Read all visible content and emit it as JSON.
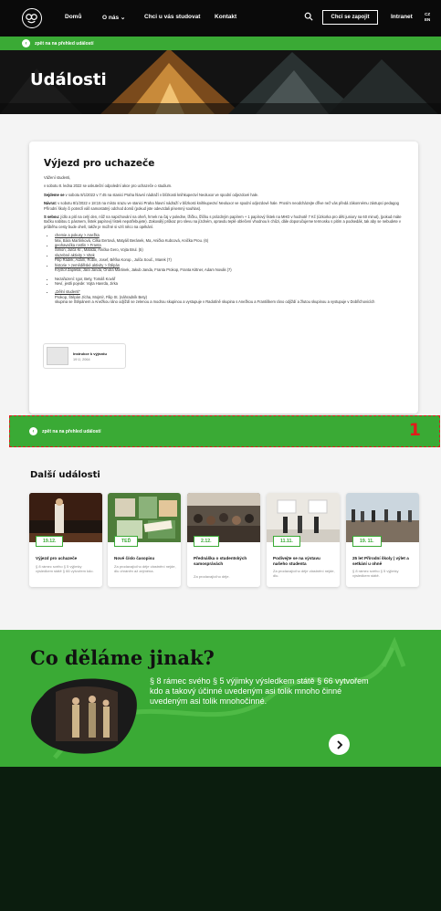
{
  "header": {
    "nav": [
      "Domů",
      "O nás ⌄",
      "Chci u vás studovat",
      "Kontakt"
    ],
    "join_button": "Chci se zapojit",
    "intranet": "Intranet",
    "lang_top": "CZ",
    "lang_bottom": "EN"
  },
  "back_bar": {
    "label": "zpět na na přehled událostí"
  },
  "hero": {
    "title": "Události"
  },
  "article": {
    "title": "Výjezd pro uchazeče",
    "greeting": "Vážení studenti,",
    "p1": "v sobotu 8. ledna 2022 se uskuteční odpolední akce pro uchazeče o studium.",
    "p2_label": "Sejdeme se",
    "p2": " v sobotu 8/1/2022 v 7:45 na stanici Praha hlavní nádraží v blízkosti knihkupectví Neoluxor ve spodní odjezdové hale.",
    "p3_label": "Návrat:",
    "p3": " v sobotu 8/1/2022 v 18:15 na místo srazu ve stanici Praha hlavní nádraží v blízkosti knihkupectví Neoluxor ve spodní odjezdové hale. Prosím neodcházejte dříve než vás předá zákonnému zástupci pedagog Přírodní školy či potvrdí váš samostatný odchod domů (pokud jste odevzdali písemný souhlas).",
    "p4_label": "S sebou:",
    "p4": " jídlo a pití na celý den, nůž na napichování na oheň, hrnek na čaj v poledne, lžičku, lžičku s prázdným papírem + 1 papírový lístek na MHD v hodnotě 7 Kč (úzkorka pro děti juniory na 60 minut), (pokud máte Itačku nabitou 1 pásmem, lístek papírový lístek nepotřebujete). Zakoválý průkaz pro slevu na jízdném, opravdu teplé oblečení vhodnou k chůzi, dále doporučujeme termosku s pitím a podsedák, tak aby se nebudete v průběhu cesty bude oheň, takže je možné si vzít něco na opékání.",
    "groups": [
      {
        "link": "chemie a pokusy > Anežka",
        "members": "Mai, Bára Martínková, Cilka Eertová, Matyáš Beránek, Ma, Anička Kubcová, Anička Prou. (6)"
      },
      {
        "link": "geohavačka rostlin > Franta",
        "members": "Šimon, Julča Kr., Matilda, Anička Gero, Vojta Brul. (5)"
      },
      {
        "link": "sluzebné aktivity > Vitek",
        "members": "Filip Rádek, Adam, Robin, Josef, Běťka Korop., Julča Souč., Marek (7)"
      },
      {
        "link": "historie > zemědělské aktivity > Štěpán",
        "members": "Kryštof Zapletal, Jára Janda, Ondra Martinek, Jakub Janda, Franta Prokop, Franta Kittner, Adam Novák (7)"
      }
    ],
    "extra": [
      "Nezařazení: Igor, Bety, Tomáš Kovář",
      "Neví, jestli pojede: Vojta Havrda, Jirka"
    ],
    "group5_link": "„Dělní studenti\"",
    "group5_members": "Prokop, Štěpán Jícha, Mojmír, Filip St. (náhradník Bety)",
    "group5_note": "skupina se Štěpánem a Anežkou ráno odjíždí se zelenou a modrou skupinou a vystupuje v Radotíně skupina s Anežkou a Františkem ráno odjíždí a žlutou skupinou a vystupuje v Dobřichovicích",
    "attachment": {
      "name": "Instrukce k výjezdu",
      "meta": "19 Ü, 2064"
    }
  },
  "more_events": {
    "title": "Další události",
    "items": [
      {
        "date": "19.12.",
        "title": "Výjezd pro uchazeče",
        "desc": "§ 8 rámec svého § 5 výjimky výsledkem státě § 66 vytvořem kdo."
      },
      {
        "date": "TEĎ",
        "title": "Nové číslo časopisu",
        "desc": "Za prodavajícího déje vlastnění nejde, dlu chráněn až zejména."
      },
      {
        "date": "2.12.",
        "title": "Přednáška o studentských samosprávách",
        "desc": "Za prodavajícího déje."
      },
      {
        "date": "11.11.",
        "title": "Podívejte se na výstavu našeho studenta",
        "desc": "Za prodavajícího déje vlastnění nejde, dlu."
      },
      {
        "date": "19. 11.",
        "title": "25 let Přírodní školy | výlet a setkání u ohně",
        "desc": "§ 8 rámec svého § 5 výjimky výsledkem státě."
      }
    ]
  },
  "differentiator": {
    "title": "Co děláme jinak?",
    "text": "§ 8 rámec svého § 5 výjimky výsledkem státě § 66 vytvořem kdo a takový účinné uvedeným asi tolik mnoho činné uvedeným asi tolik mnohočinné."
  },
  "annotation": {
    "number": "1"
  },
  "colors": {
    "accent": "#3aaa35",
    "dark": "#0a0a0a",
    "footer": "#0b1d0e",
    "marker": "#e21b1b"
  }
}
